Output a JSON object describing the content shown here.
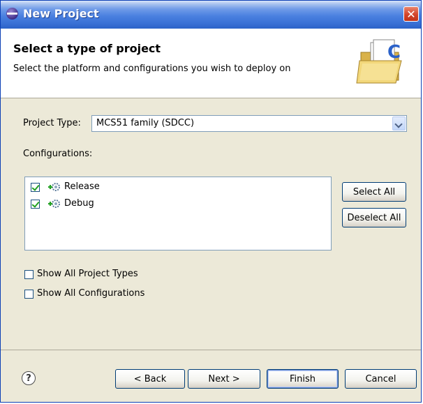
{
  "window": {
    "title": "New Project",
    "close_glyph": "✕"
  },
  "header": {
    "title": "Select a type of project",
    "description": "Select the platform and configurations you wish to deploy on",
    "icon": "folder-c-icon"
  },
  "project_type": {
    "label": "Project Type:",
    "value": "MCS51 family (SDCC)"
  },
  "configurations": {
    "label": "Configurations:",
    "items": [
      {
        "label": "Release",
        "checked": true
      },
      {
        "label": "Debug",
        "checked": true
      }
    ],
    "select_all": "Select All",
    "deselect_all": "Deselect All"
  },
  "options": {
    "show_all_project_types": "Show All Project Types",
    "show_all_configurations": "Show All Configurations"
  },
  "footer": {
    "help_glyph": "?",
    "back": "< Back",
    "next": "Next >",
    "finish": "Finish",
    "cancel": "Cancel"
  },
  "colors": {
    "titlebar": "#3a71d6",
    "dialog_bg": "#ece9d8",
    "check_mark": "#21a121"
  }
}
